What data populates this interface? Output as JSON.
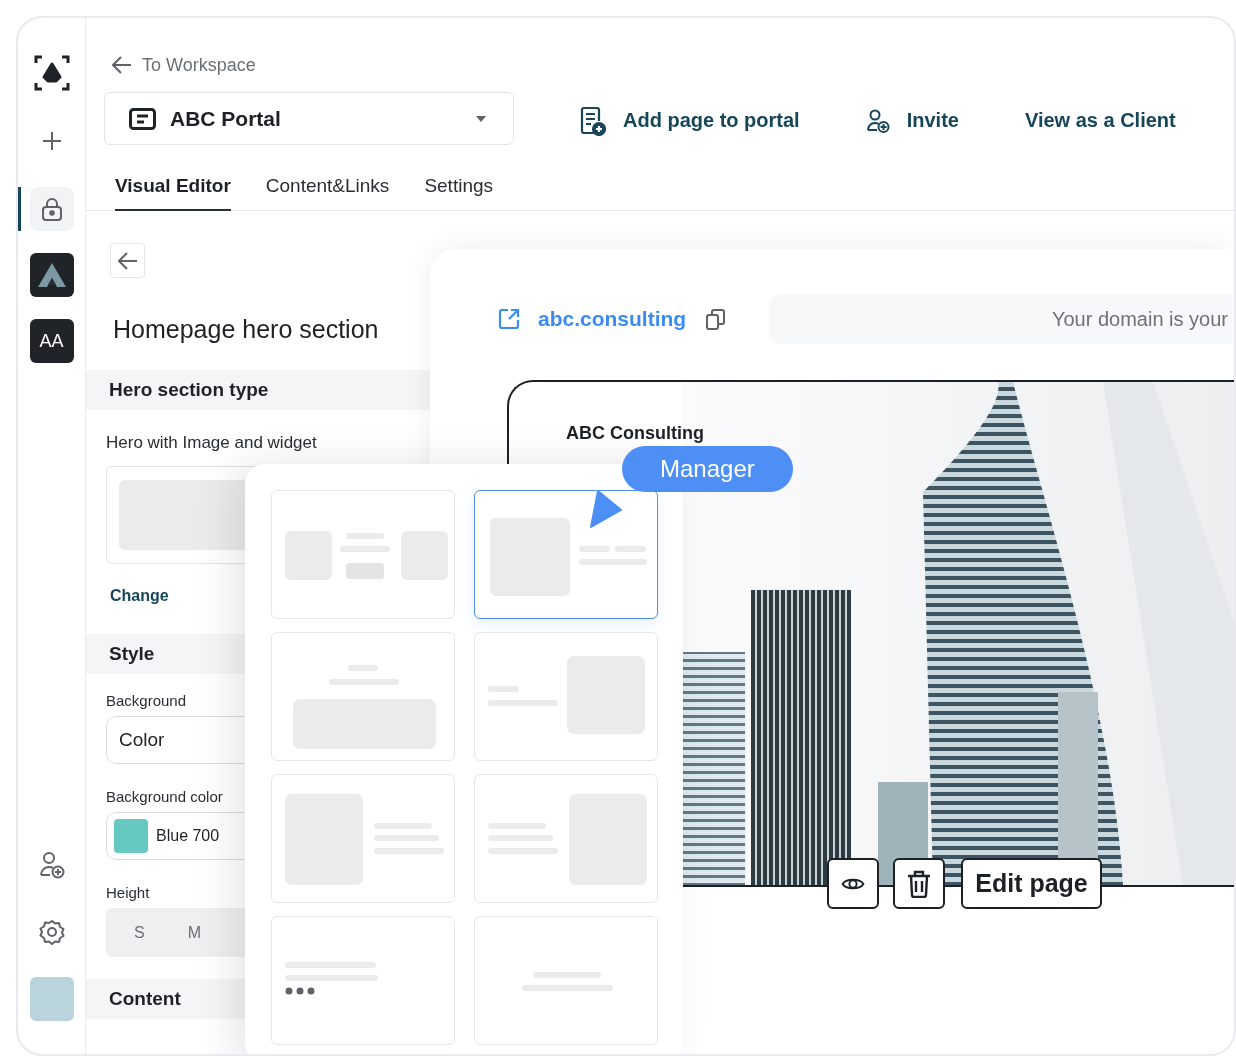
{
  "sidebar": {
    "nav_items": [
      {
        "selected": false
      },
      {
        "selected": true
      }
    ],
    "workspace_badge": "AA"
  },
  "header": {
    "back_link": "To Workspace",
    "portal_select": {
      "value": "ABC Portal"
    },
    "actions": [
      {
        "label": "Add page to portal"
      },
      {
        "label": "Invite"
      },
      {
        "label": "View as a Client"
      }
    ]
  },
  "tabs": [
    {
      "label": "Visual Editor",
      "selected": true
    },
    {
      "label": "Content&Links",
      "selected": false
    },
    {
      "label": "Settings",
      "selected": false
    }
  ],
  "editor": {
    "title": "Homepage hero section",
    "hero_type": {
      "heading": "Hero section type",
      "value": "Hero with Image and widget",
      "change": "Change"
    },
    "style": {
      "heading": "Style",
      "background": {
        "label": "Background",
        "value": "Color"
      },
      "background_color": {
        "label": "Background color",
        "value": "Blue 700",
        "color": "#66c9c1"
      },
      "height": {
        "label": "Height",
        "options": [
          {
            "label": "S",
            "selected": false
          },
          {
            "label": "M",
            "selected": false
          }
        ]
      }
    },
    "content_heading": "Content"
  },
  "preview": {
    "domain_link": "abc.consulting",
    "domain_field": {
      "placeholder": "Your domain is your"
    },
    "site": {
      "brand": "ABC Consulting",
      "role_badge": "Manager",
      "edit_button": "Edit page"
    }
  },
  "layout_picker": {
    "layouts": [
      {
        "kind": "columns",
        "selected": false
      },
      {
        "kind": "media-left",
        "selected": true
      },
      {
        "kind": "banner",
        "selected": false
      },
      {
        "kind": "media-right",
        "selected": false
      },
      {
        "kind": "media-left-tall",
        "selected": false
      },
      {
        "kind": "media-right-tall",
        "selected": false
      },
      {
        "kind": "text-more",
        "selected": false
      },
      {
        "kind": "text-center",
        "selected": false
      }
    ]
  }
}
